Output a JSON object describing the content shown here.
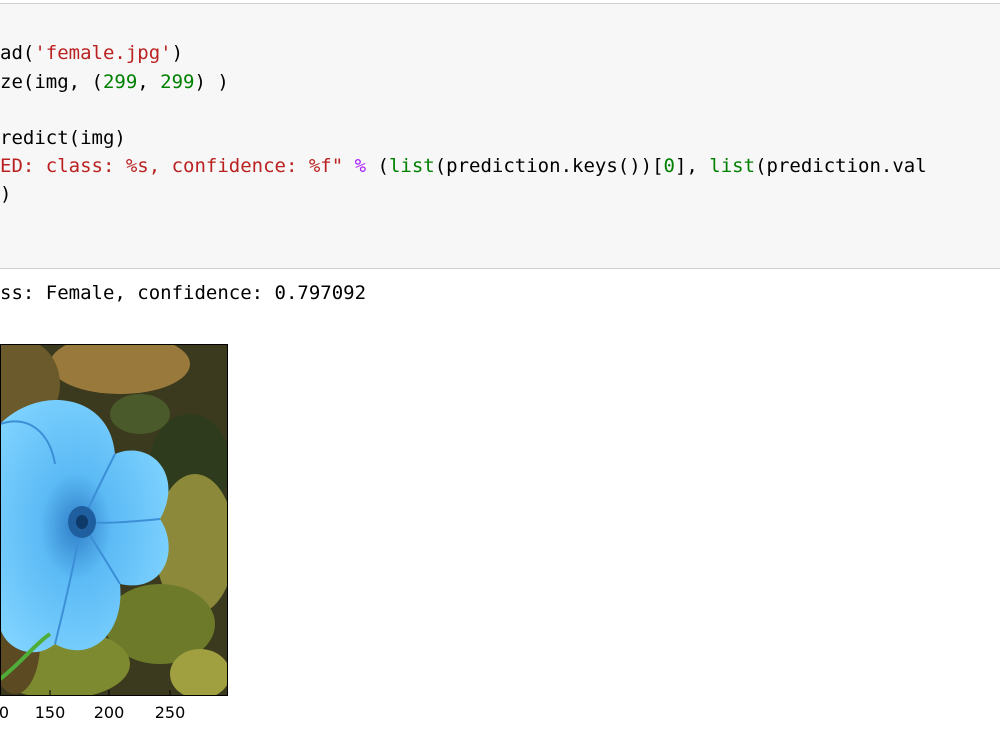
{
  "cell": {
    "code_lines": [
      {
        "segments": [
          {
            "t": "ad(",
            "c": ""
          },
          {
            "t": "'female.jpg'",
            "c": "tok-str"
          },
          {
            "t": ")",
            "c": ""
          }
        ]
      },
      {
        "segments": [
          {
            "t": "ze(img, (",
            "c": ""
          },
          {
            "t": "299",
            "c": "tok-num"
          },
          {
            "t": ", ",
            "c": ""
          },
          {
            "t": "299",
            "c": "tok-num"
          },
          {
            "t": ") )",
            "c": ""
          }
        ]
      },
      {
        "segments": []
      },
      {
        "segments": [
          {
            "t": "redict(img)",
            "c": ""
          }
        ]
      },
      {
        "segments": [
          {
            "t": "ED: class: %s, confidence: %f\"",
            "c": "tok-str"
          },
          {
            "t": " ",
            "c": ""
          },
          {
            "t": "%",
            "c": "tok-op"
          },
          {
            "t": " (",
            "c": ""
          },
          {
            "t": "list",
            "c": "tok-builtin"
          },
          {
            "t": "(prediction.keys())[",
            "c": ""
          },
          {
            "t": "0",
            "c": "tok-num"
          },
          {
            "t": "], ",
            "c": ""
          },
          {
            "t": "list",
            "c": "tok-builtin"
          },
          {
            "t": "(prediction.val",
            "c": ""
          }
        ]
      },
      {
        "segments": [
          {
            "t": ")",
            "c": ""
          }
        ]
      }
    ],
    "output": "ss: Female, confidence: 0.797092"
  },
  "plot": {
    "x_ticks": [
      "0",
      "150",
      "200",
      "250"
    ]
  },
  "colors": {
    "cell_bg": "#f7f7f7",
    "string": "#ba2121",
    "number": "#008000",
    "operator": "#aa22ff"
  }
}
